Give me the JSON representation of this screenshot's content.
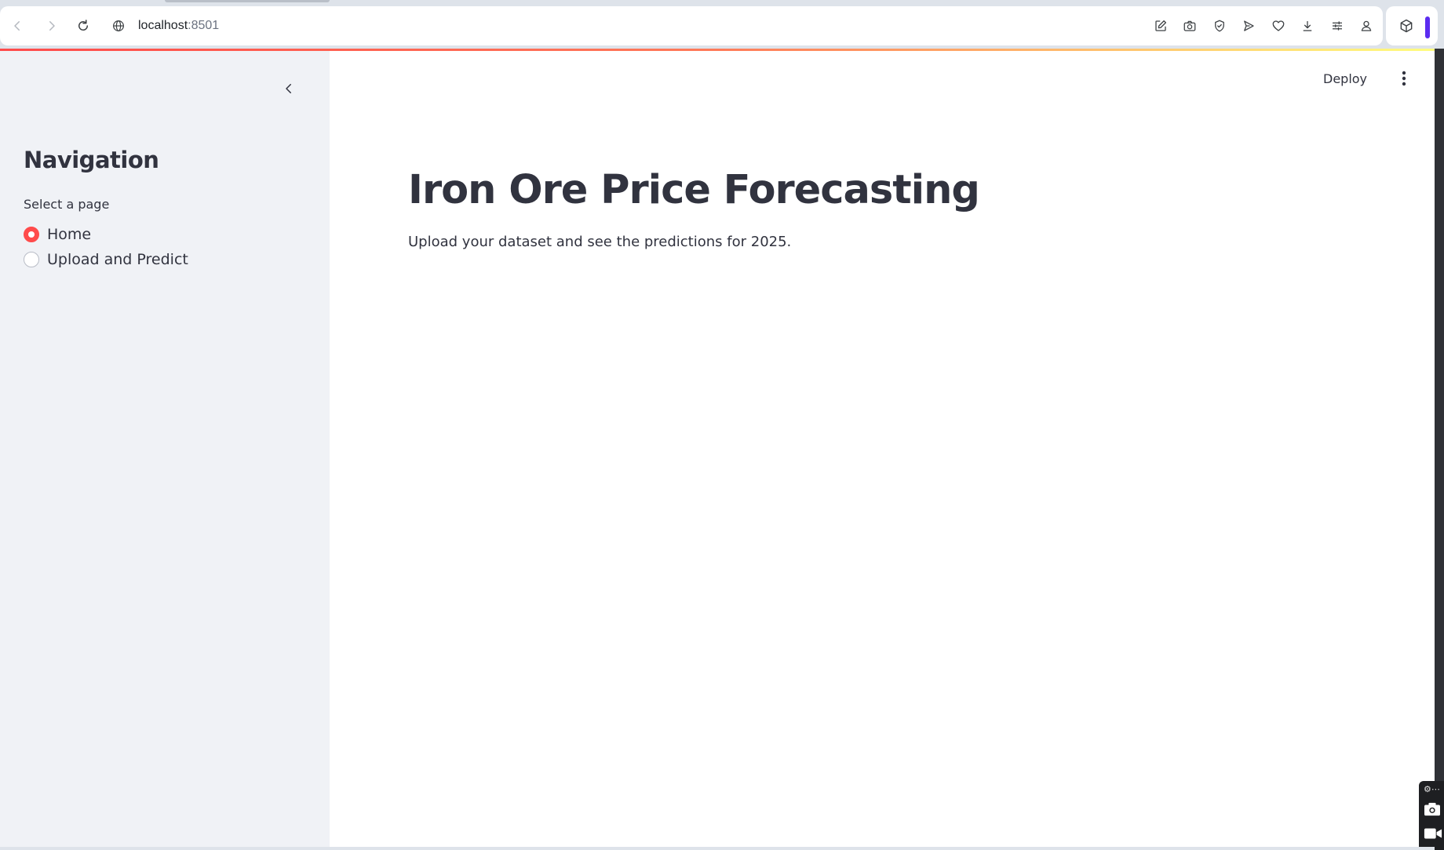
{
  "browser": {
    "url_host": "localhost",
    "url_port": ":8501"
  },
  "sidebar": {
    "title": "Navigation",
    "radio_label": "Select a page",
    "options": [
      {
        "label": "Home",
        "selected": true
      },
      {
        "label": "Upload and Predict",
        "selected": false
      }
    ]
  },
  "header": {
    "deploy_label": "Deploy"
  },
  "main": {
    "title": "Iron Ore Price Forecasting",
    "subtitle": "Upload your dataset and see the predictions for 2025."
  },
  "colors": {
    "accent": "#ff4b4b",
    "sidebar_bg": "#f0f2f6",
    "text": "#31333f"
  },
  "icons": {
    "back": "arrow-left-icon",
    "forward": "arrow-right-icon",
    "reload": "reload-icon",
    "site_info": "globe-icon",
    "toolbar": [
      "edit-icon",
      "camera-icon",
      "shield-icon",
      "send-icon",
      "heart-icon",
      "download-icon",
      "sliders-icon",
      "profile-icon"
    ],
    "extensions": "cube-icon",
    "collapse": "chevron-left-icon",
    "menu": "kebab-menu-icon"
  }
}
